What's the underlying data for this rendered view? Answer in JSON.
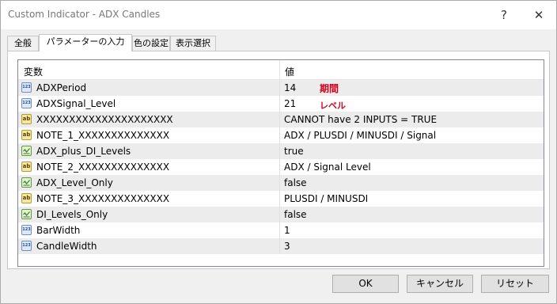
{
  "window": {
    "title": "Custom Indicator - ADX Candles",
    "help": "?",
    "close": "✕"
  },
  "tabs": [
    {
      "label": "全般"
    },
    {
      "label": "パラメーターの入力"
    },
    {
      "label": "色の設定"
    },
    {
      "label": "表示選択"
    }
  ],
  "grid": {
    "col_variable": "変数",
    "col_value": "値",
    "rows": [
      {
        "name": "ADXPeriod",
        "value": "14",
        "type": "int"
      },
      {
        "name": "ADXSignal_Level",
        "value": "21",
        "type": "int"
      },
      {
        "name": "XXXXXXXXXXXXXXXXXXXXX",
        "value": "CANNOT have 2 INPUTS = TRUE",
        "type": "string"
      },
      {
        "name": "NOTE_1_XXXXXXXXXXXXXX",
        "value": "ADX / PLUSDI / MINUSDI / Signal",
        "type": "string"
      },
      {
        "name": "ADX_plus_DI_Levels",
        "value": "true",
        "type": "bool"
      },
      {
        "name": "NOTE_2_XXXXXXXXXXXXXX",
        "value": "ADX / Signal Level",
        "type": "string"
      },
      {
        "name": "ADX_Level_Only",
        "value": "false",
        "type": "bool"
      },
      {
        "name": "NOTE_3_XXXXXXXXXXXXXX",
        "value": "PLUSDI / MINUSDI",
        "type": "string"
      },
      {
        "name": "DI_Levels_Only",
        "value": "false",
        "type": "bool"
      },
      {
        "name": "BarWidth",
        "value": "1",
        "type": "int"
      },
      {
        "name": "CandleWidth",
        "value": "3",
        "type": "int"
      }
    ]
  },
  "annotations": {
    "period": "期間",
    "level": "レベル",
    "color": "#d0021b"
  },
  "buttons": {
    "ok": "OK",
    "cancel": "キャンセル",
    "reset": "リセット"
  }
}
